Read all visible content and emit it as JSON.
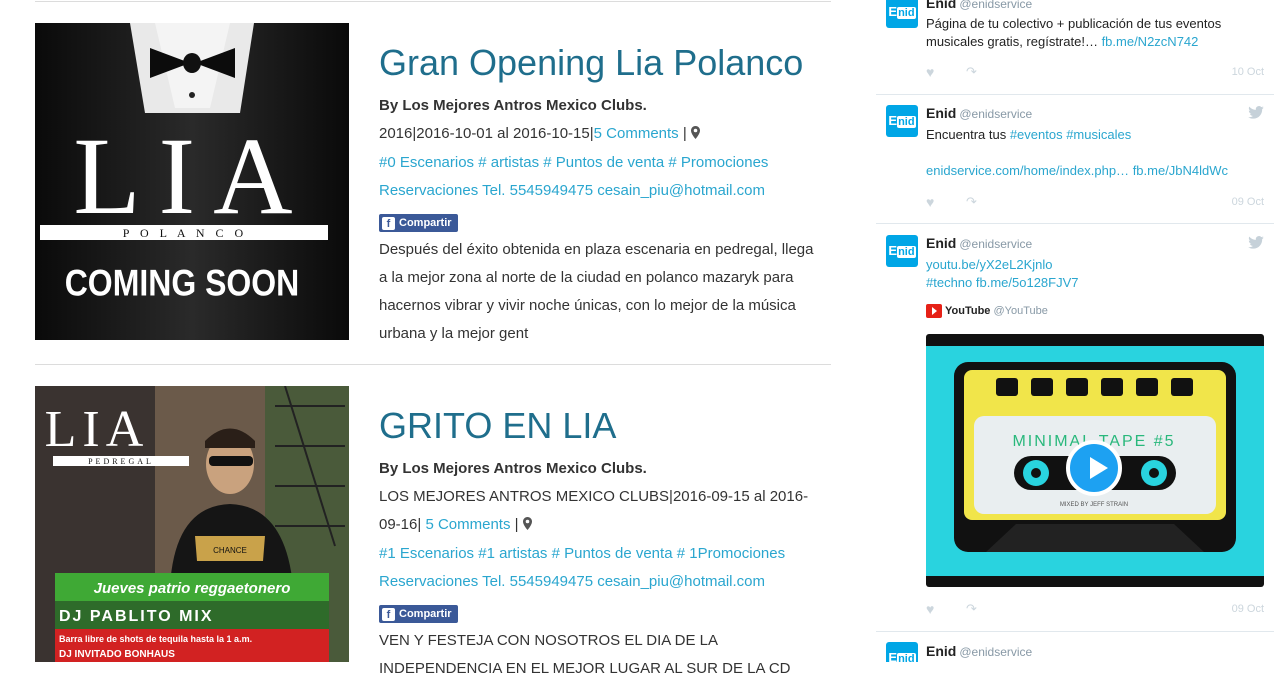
{
  "posts": [
    {
      "title": "Gran Opening Lia Polanco",
      "author": "By Los Mejores Antros Mexico Clubs.",
      "meta_prefix": "2016|2016-10-01 al 2016-10-15|",
      "comments": "5 Comments",
      "meta_suffix": "|",
      "tags": [
        "#0 Escenarios",
        "# artistas",
        "# Puntos de venta",
        "# Promociones"
      ],
      "reservations": "Reservaciones Tel. 5545949475 cesain_piu@hotmail.com",
      "share": "Compartir",
      "excerpt": "Después del éxito obtenida en plaza escenaria en pedregal, llega a la mejor zona al norte de la ciudad en polanco mazaryk para hacernos vibrar y vivir noche únicas, con lo mejor de la música urbana y la mejor gent",
      "image": {
        "logo": "LIA",
        "sub": "P O L A N C O",
        "tagline": "COMING SOON"
      }
    },
    {
      "title": "GRITO EN LIA",
      "author": "By Los Mejores Antros Mexico Clubs.",
      "meta_prefix": "LOS MEJORES ANTROS MEXICO CLUBS|2016-09-15 al 2016-09-16|",
      "comments": "5 Comments",
      "meta_suffix": "|",
      "tags": [
        "#1 Escenarios",
        "#1 artistas",
        "# Puntos de venta",
        "# 1Promociones"
      ],
      "reservations": "Reservaciones Tel. 5545949475 cesain_piu@hotmail.com",
      "share": "Compartir",
      "excerpt": "VEN Y FESTEJA CON NOSOTROS EL DIA DE LA INDEPENDENCIA EN EL MEJOR LUGAR AL SUR DE LA CD",
      "image": {
        "logo": "LIA",
        "sub": "PEDREGAL",
        "banner1": "Jueves patrio reggaetonero",
        "banner2": "DJ PABLITO MIX",
        "banner3": "Barra libre de shots de tequila hasta la 1 a.m.",
        "banner4": "DJ INVITADO BONHAUS",
        "shirt": "CHANCE"
      }
    }
  ],
  "tweets": [
    {
      "name": "Enid",
      "handle": "@enidservice",
      "text_plain": "Página de tu colectivo + publicación de tus eventos musicales gratis, regístrate!… ",
      "link": "fb.me/N2zcN742",
      "date": "10 Oct"
    },
    {
      "name": "Enid",
      "handle": "@enidservice",
      "text_plain": "Encuentra tus ",
      "hashtags": "#eventos #musicales",
      "link1": "enidservice.com/home/index.php…",
      "link2": "fb.me/JbN4ldWc",
      "date": "09 Oct"
    },
    {
      "name": "Enid",
      "handle": "@enidservice",
      "link1": "youtu.be/yX2eL2Kjnlo",
      "hashtag": "#techno",
      "link2": "fb.me/5o128FJV7",
      "yt_name": "YouTube",
      "yt_handle": "@YouTube",
      "video_text": "MINIMAL TAPE #5",
      "video_caption": "MIXED BY JEFF STRAIN",
      "date": "09 Oct"
    },
    {
      "name": "Enid",
      "handle": "@enidservice"
    }
  ],
  "avatar": {
    "e": "E",
    "nid": "nid"
  },
  "icons": {
    "heart": "heart-icon",
    "share": "share-icon",
    "bird": "twitter-bird-icon",
    "pin": "map-pin-icon"
  },
  "colors": {
    "title": "#1f6e8c",
    "link": "#2aa6cf",
    "facebook": "#3b5998",
    "twitter": "#1da1f2"
  }
}
